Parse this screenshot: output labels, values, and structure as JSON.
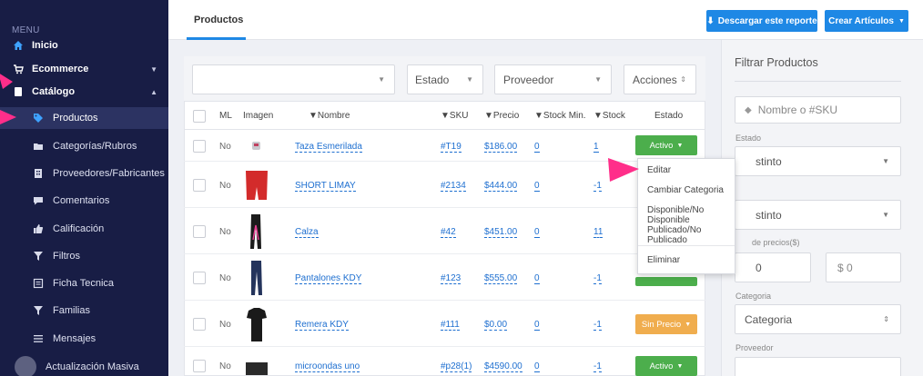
{
  "sidebar": {
    "menu_label": "MENU",
    "items": [
      {
        "label": "Inicio",
        "icon": "home-icon"
      },
      {
        "label": "Ecommerce",
        "icon": "cart-icon"
      },
      {
        "label": "Catálogo",
        "icon": "book-icon"
      },
      {
        "label": "Productos",
        "icon": "tag-icon"
      },
      {
        "label": "Categorías/Rubros",
        "icon": "folder-icon"
      },
      {
        "label": "Proveedores/Fabricantes",
        "icon": "building-icon"
      },
      {
        "label": "Comentarios",
        "icon": "comment-icon"
      },
      {
        "label": "Calificación",
        "icon": "thumbs-up-icon"
      },
      {
        "label": "Filtros",
        "icon": "filter-icon"
      },
      {
        "label": "Ficha Tecnica",
        "icon": "sheet-icon"
      },
      {
        "label": "Familias",
        "icon": "filter-icon"
      },
      {
        "label": "Mensajes",
        "icon": "list-icon"
      },
      {
        "label": "Actualización Masiva",
        "icon": "avatar"
      }
    ]
  },
  "header": {
    "tab": "Productos",
    "download_button": "Descargar este reporte",
    "create_button": "Crear Artículos"
  },
  "filter_bar": {
    "estado": "Estado",
    "proveedor": "Proveedor",
    "acciones": "Acciones"
  },
  "table": {
    "headers": [
      "ML",
      "Imagen",
      "Nombre",
      "SKU",
      "Precio",
      "Stock Min.",
      "Stock",
      "Estado"
    ],
    "rows": [
      {
        "ml": "No",
        "name": "Taza Esmerilada",
        "sku": "#T19",
        "price": "$186.00",
        "stock_min": "0",
        "stock": "1",
        "status": "Activo"
      },
      {
        "ml": "No",
        "name": "SHORT LIMAY",
        "sku": "#2134",
        "price": "$444.00",
        "stock_min": "0",
        "stock": "-1",
        "status": ""
      },
      {
        "ml": "No",
        "name": "Calza",
        "sku": "#42",
        "price": "$451.00",
        "stock_min": "0",
        "stock": "11",
        "status": ""
      },
      {
        "ml": "No",
        "name": "Pantalones KDY",
        "sku": "#123",
        "price": "$555.00",
        "stock_min": "0",
        "stock": "-1",
        "status": ""
      },
      {
        "ml": "No",
        "name": "Remera KDY",
        "sku": "#111",
        "price": "$0.00",
        "stock_min": "0",
        "stock": "-1",
        "status": "Sin Precio"
      },
      {
        "ml": "No",
        "name": "microondas uno",
        "sku": "#p28(1)",
        "price": "$4590.00",
        "stock_min": "0",
        "stock": "-1",
        "status": "Activo"
      }
    ]
  },
  "dropdown": {
    "items": [
      "Editar",
      "Cambiar Categoria",
      "Disponible/No Disponible",
      "Publicado/No Publicado",
      "Eliminar"
    ]
  },
  "filters": {
    "title": "Filtrar Productos",
    "search_placeholder": "Nombre o #SKU",
    "estado_label": "Estado",
    "estado_value": "stinto",
    "second_value": "stinto",
    "price_label": "de precios($)",
    "price_min": "0",
    "price_max": "$ 0",
    "categoria_label": "Categoria",
    "categoria_value": "Categoria",
    "proveedor_label": "Proveedor"
  },
  "colors": {
    "sidebar_bg": "#181d45",
    "accent_blue": "#1e88e5",
    "active_green": "#4cae4c",
    "warning_orange": "#f0ad4e",
    "pink_arrow": "#ff2e8a"
  }
}
